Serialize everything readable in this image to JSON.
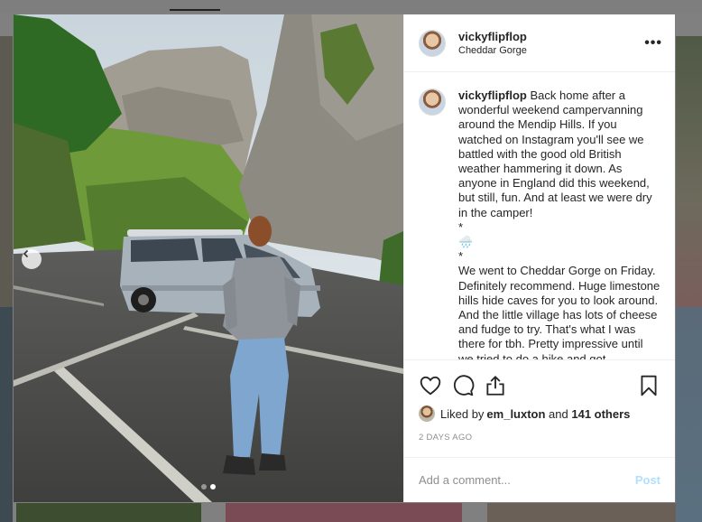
{
  "colors": {
    "overlay": "#808080",
    "accent_link": "#b2dffc",
    "text": "#262626",
    "muted": "#8e8e8e"
  },
  "post": {
    "author": "vickyflipflop",
    "location": "Cheddar Gorge",
    "more_icon": "more-horizontal-icon",
    "caption_user": "vickyflipflop",
    "caption_text": " Back home after a wonderful weekend campervanning around the Mendip Hills. If you watched on Instagram you'll see we battled with the good old British weather hammering it down. As anyone in England did this weekend, but still, fun. And at least we were dry in the camper!\n*\n🌧️\n*\nWe went to Cheddar Gorge on Friday. Definitely recommend. Huge limestone hills hide caves for you to look around. And the little village has lots of cheese and fudge to try. That's what I was there for tbh. Pretty impressive until we tried to do a hike and got absolutely soaked through. Quick pie",
    "carousel": {
      "count": 2,
      "active_index": 1
    }
  },
  "actions": {
    "icons": [
      "heart-icon",
      "comment-icon",
      "share-icon",
      "bookmark-icon"
    ],
    "liked_by_prefix": "Liked by ",
    "liked_by_user": "em_luxton",
    "liked_by_middle": " and ",
    "liked_by_count": "141 others",
    "timestamp": "2 DAYS AGO"
  },
  "comment_box": {
    "placeholder": "Add a comment...",
    "post_label": "Post"
  }
}
